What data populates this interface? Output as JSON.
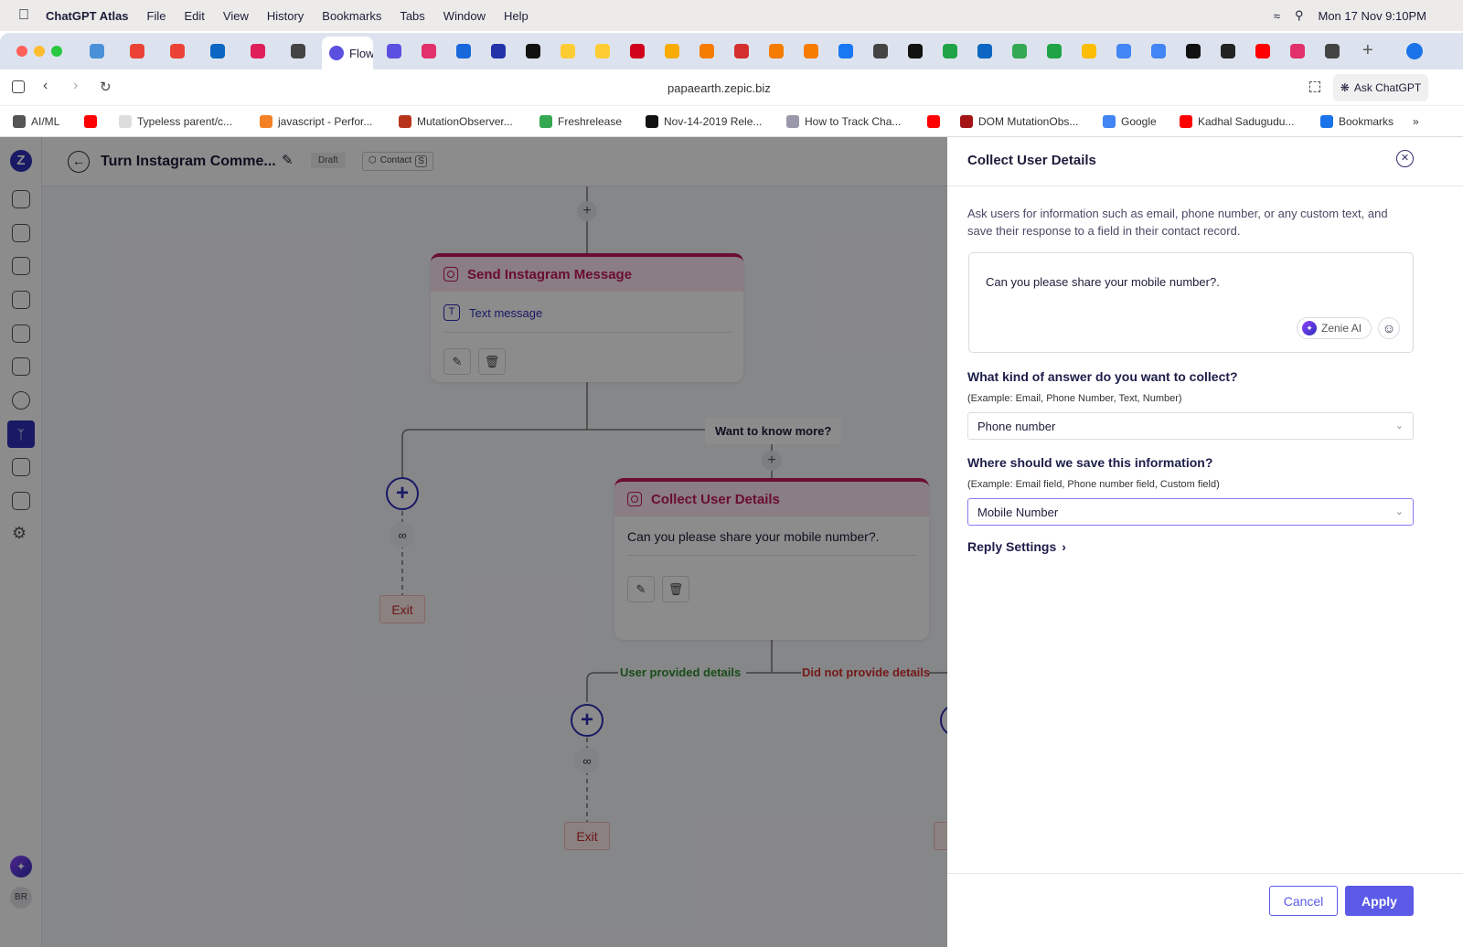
{
  "menubar": {
    "app": "ChatGPT Atlas",
    "items": [
      "File",
      "Edit",
      "View",
      "History",
      "Bookmarks",
      "Tabs",
      "Window",
      "Help"
    ],
    "clock": "Mon 17 Nov  9:10PM"
  },
  "tabs": {
    "active_label": "Flow",
    "icons": [
      {
        "name": "mail-icon",
        "color": "#4a90d9"
      },
      {
        "name": "gmail-icon",
        "color": "#ea4335"
      },
      {
        "name": "gmail-icon",
        "color": "#ea4335"
      },
      {
        "name": "linkedin-icon",
        "color": "#0a66c2"
      },
      {
        "name": "slack-icon",
        "color": "#e01e5a"
      },
      {
        "name": "openai-icon",
        "color": "#444"
      },
      {
        "name": "zepic-icon",
        "color": "#5b4fe0"
      },
      {
        "name": "instagram-icon",
        "color": "#e1306c"
      },
      {
        "name": "jira-icon",
        "color": "#1868db"
      },
      {
        "name": "infinity-icon",
        "color": "#2233aa"
      },
      {
        "name": "app-icon",
        "color": "#111"
      },
      {
        "name": "huggingface-icon",
        "color": "#ffcc33"
      },
      {
        "name": "huggingface-icon",
        "color": "#ffcc33"
      },
      {
        "name": "opera-icon",
        "color": "#d0021b"
      },
      {
        "name": "colab-icon",
        "color": "#f9ab00"
      },
      {
        "name": "box-icon",
        "color": "#f57c00"
      },
      {
        "name": "app-icon",
        "color": "#d32f2f"
      },
      {
        "name": "box-icon",
        "color": "#f57c00"
      },
      {
        "name": "box-icon",
        "color": "#f57c00"
      },
      {
        "name": "facebook-icon",
        "color": "#1877f2"
      },
      {
        "name": "openai-icon",
        "color": "#444"
      },
      {
        "name": "circle-icon",
        "color": "#111"
      },
      {
        "name": "badge-icon",
        "color": "#1ea446"
      },
      {
        "name": "linkedin-icon",
        "color": "#0a66c2"
      },
      {
        "name": "drive-icon",
        "color": "#34a853"
      },
      {
        "name": "sheets-icon",
        "color": "#1ea446"
      },
      {
        "name": "drive-icon",
        "color": "#fbbc04"
      },
      {
        "name": "docs-icon",
        "color": "#4285f4"
      },
      {
        "name": "docs-icon",
        "color": "#4285f4"
      },
      {
        "name": "github-icon",
        "color": "#111"
      },
      {
        "name": "app-icon",
        "color": "#222"
      },
      {
        "name": "youtube-icon",
        "color": "#ff0000"
      },
      {
        "name": "instagram-icon",
        "color": "#e1306c"
      },
      {
        "name": "openai-icon",
        "color": "#444"
      }
    ]
  },
  "address": {
    "url": "papaearth.zepic.biz",
    "ask": "Ask ChatGPT"
  },
  "bookmarks": [
    {
      "label": "AI/ML",
      "color": "#555"
    },
    {
      "label": "",
      "color": "#ff0000"
    },
    {
      "label": "Typeless parent/c...",
      "color": "#ddd"
    },
    {
      "label": "javascript - Perfor...",
      "color": "#f48024"
    },
    {
      "label": "MutationObserver...",
      "color": "#b7341b"
    },
    {
      "label": "Freshrelease",
      "color": "#35a852"
    },
    {
      "label": "Nov-14-2019 Rele...",
      "color": "#111"
    },
    {
      "label": "How to Track Cha...",
      "color": "#99a"
    },
    {
      "label": "",
      "color": "#ff0000"
    },
    {
      "label": "DOM MutationObs...",
      "color": "#a31515"
    },
    {
      "label": "Google",
      "color": "#4285f4"
    },
    {
      "label": "Kadhal Sadugudu...",
      "color": "#ff0000"
    },
    {
      "label": "Bookmarks",
      "color": "#1a73e8"
    }
  ],
  "header": {
    "title": "Turn Instagram Comme...",
    "status": "Draft",
    "contact": "Contact",
    "contact_badge": "S"
  },
  "sidebar": {
    "avatar": "BR",
    "active": "flows"
  },
  "flow": {
    "card1": {
      "title": "Send Instagram Message",
      "item": "Text message"
    },
    "branch": "Want to know more?",
    "card2": {
      "title": "Collect User Details",
      "text": "Can you please share your mobile number?."
    },
    "yes": "User provided details",
    "no": "Did not provide details",
    "exit": "Exit"
  },
  "panel": {
    "title": "Collect User Details",
    "description": "Ask users for information such as email, phone number, or any custom text, and save their response to a field in their contact record.",
    "message": "Can you please share your mobile number?.",
    "ai": "Zenie AI",
    "q1": "What kind of answer do you want to collect?",
    "q1_hint": "(Example: Email, Phone Number, Text, Number)",
    "q1_value": "Phone number",
    "q2": "Where should we save this information?",
    "q2_hint": "(Example: Email field, Phone number field, Custom field)",
    "q2_value": "Mobile Number",
    "reply": "Reply Settings",
    "cancel": "Cancel",
    "apply": "Apply"
  },
  "colors": {
    "accent": "#5b5be8",
    "brand": "#2e2eb8",
    "instagram": "#c2185b",
    "success": "#2e8b2e",
    "danger": "#d32f2f"
  }
}
